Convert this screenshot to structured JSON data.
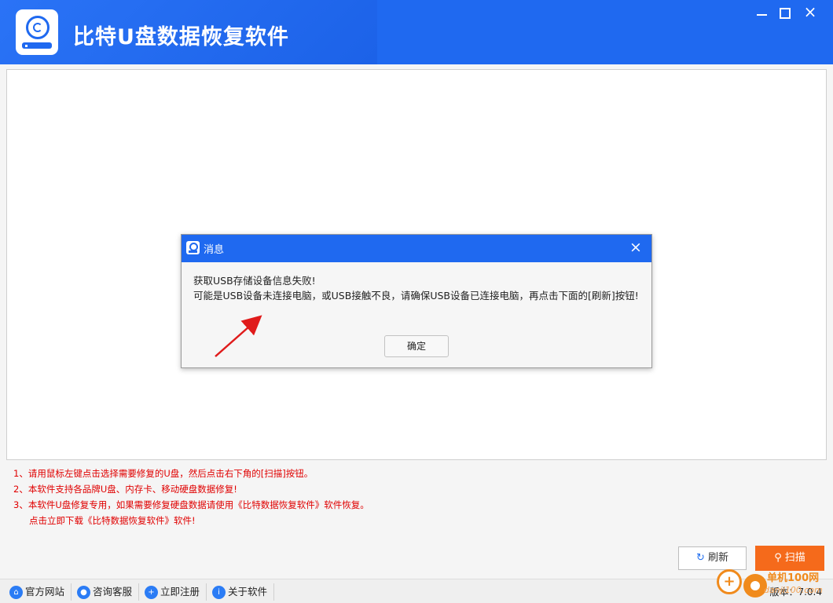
{
  "header": {
    "title": "比特U盘数据恢复软件",
    "logo_icon": "usb-drive-recovery-icon",
    "brand_color": "#1f69f0"
  },
  "window_controls": {
    "minimize": "minimize",
    "maximize": "maximize",
    "close": "×"
  },
  "notes": [
    "1、请用鼠标左键点击选择需要修复的U盘，然后点击右下角的[扫描]按钮。",
    "2、本软件支持各品牌U盘、内存卡、移动硬盘数据修复!",
    "3、本软件U盘修复专用，如果需要修复硬盘数据请使用《比特数据恢复软件》软件恢复。",
    "点击立即下载《比特数据恢复软件》软件!"
  ],
  "buttons": {
    "refresh": "刷新",
    "scan": "扫描",
    "scan_color": "#f56a1b"
  },
  "statusbar": {
    "items": [
      {
        "label": "官方网站",
        "icon": "home-icon"
      },
      {
        "label": "咨询客服",
        "icon": "chat-icon"
      },
      {
        "label": "立即注册",
        "icon": "user-add-icon"
      },
      {
        "label": "关于软件",
        "icon": "info-icon"
      }
    ],
    "version": "版本：7.0.4"
  },
  "dialog": {
    "title": "消息",
    "close": "×",
    "message_line1": "获取USB存储设备信息失败!",
    "message_line2": "可能是USB设备未连接电脑，或USB接触不良，请确保USB设备已连接电脑，再点击下面的[刷新]按钮!",
    "ok": "确定"
  },
  "watermark": {
    "name": "单机100网",
    "sub": "danji100.com"
  }
}
